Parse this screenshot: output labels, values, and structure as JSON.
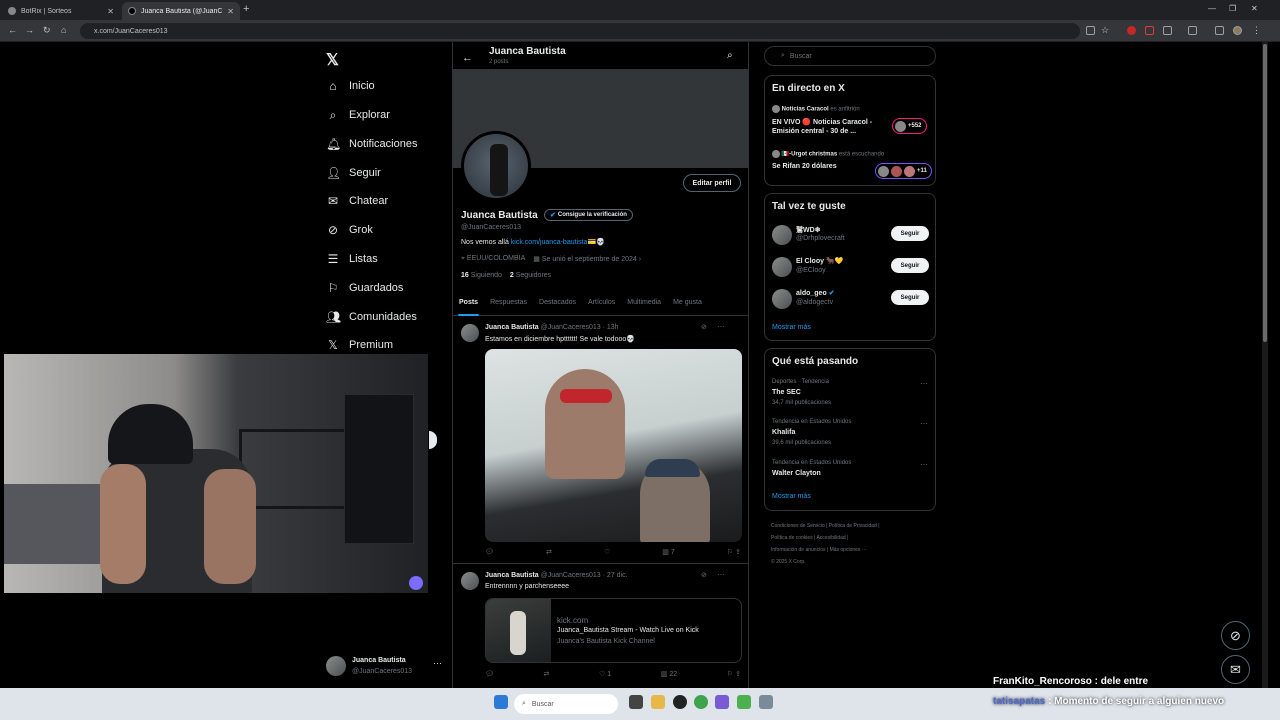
{
  "browser": {
    "tabs": [
      {
        "title": "BotRix | Sorteos"
      },
      {
        "title": "Juanca Bautista (@JuanCacer…"
      }
    ],
    "url": "x.com/JuanCaceres013"
  },
  "nav": {
    "logo": "𝕏",
    "items": [
      {
        "label": "Inicio",
        "icon": "home-icon"
      },
      {
        "label": "Explorar",
        "icon": "search-icon"
      },
      {
        "label": "Notificaciones",
        "icon": "bell-icon"
      },
      {
        "label": "Seguir",
        "icon": "follow-icon"
      },
      {
        "label": "Chatear",
        "icon": "mail-icon"
      },
      {
        "label": "Grok",
        "icon": "grok-icon"
      },
      {
        "label": "Listas",
        "icon": "list-icon"
      },
      {
        "label": "Guardados",
        "icon": "bookmark-icon"
      },
      {
        "label": "Comunidades",
        "icon": "communities-icon"
      },
      {
        "label": "Premium",
        "icon": "x-icon"
      }
    ],
    "account": {
      "name": "Juanca Bautista",
      "handle": "@JuanCaceres013"
    }
  },
  "profile": {
    "header_name": "Juanca Bautista",
    "header_posts": "2 posts",
    "name": "Juanca Bautista",
    "verify_label": "Consigue la verificación",
    "handle": "@JuanCaceres013",
    "edit_label": "Editar perfil",
    "bio_text": "Nos vemos allá ",
    "bio_link": "kick.com/juanca-bautista",
    "bio_emoji": "💳💀",
    "location": "EEUU/COLOMBIA",
    "joined": "Se unió el septiembre de 2024",
    "following_count": "16",
    "following_label": "Siguiendo",
    "followers_count": "2",
    "followers_label": "Seguidores",
    "tabs": [
      "Posts",
      "Respuestas",
      "Destacados",
      "Artículos",
      "Multimedia",
      "Me gusta"
    ]
  },
  "posts": [
    {
      "name": "Juanca Bautista",
      "handle": "@JuanCaceres013",
      "time": "· 13h",
      "text": "Estamos en diciembre hptttttt! Se vale todooo💀",
      "views": "7",
      "likes": ""
    },
    {
      "name": "Juanca Bautista",
      "handle": "@JuanCaceres013",
      "time": "· 27 dic.",
      "text": "Entrennnn y parchenseeee",
      "card_domain": "kick.com",
      "card_title": "Juanca_Bautista Stream - Watch Live on Kick",
      "card_desc": "Juanca's Bautista Kick Channel",
      "likes": "1",
      "views": "22"
    }
  ],
  "right": {
    "search_placeholder": "Buscar",
    "live_title": "En directo en X",
    "live": [
      {
        "host": "Noticias Caracol",
        "role": "es anfitrión",
        "title_line1": "EN VIVO 🔴 Noticias Caracol -",
        "title_line2": "Emisión central - 30 de ...",
        "count": "+552"
      },
      {
        "host": "🇲🇽-Urgot christmas",
        "role": "está escuchando",
        "title_line1": "Se Rifan 20 dólares",
        "count": "+11"
      }
    ],
    "wtf_title": "Tal vez te guste",
    "wtf": [
      {
        "name": "鷲WD❄",
        "handle": "@Drhplovecraft",
        "button": "Seguir"
      },
      {
        "name": "El Clooy 🐂💛",
        "handle": "@EClooy",
        "button": "Seguir"
      },
      {
        "name": "aldo_geo",
        "handle": "@aldogectv",
        "button": "Seguir"
      }
    ],
    "show_more": "Mostrar más",
    "trends_title": "Qué está pasando",
    "trends": [
      {
        "context": "Deportes · Tendencia",
        "topic": "The SEC",
        "posts": "34,7 mil publicaciones"
      },
      {
        "context": "Tendencia en Estados Unidos",
        "topic": "Khalifa",
        "posts": "39,6 mil publicaciones"
      },
      {
        "context": "Tendencia en Estados Unidos",
        "topic": "Walter Clayton",
        "posts": ""
      }
    ],
    "footer": [
      "Condiciones de Servicio",
      "Política de Privacidad",
      "Política de cookies",
      "Accesibilidad",
      "Información de anuncios",
      "Más opciones ···",
      "© 2025 X Corp."
    ]
  },
  "chat": {
    "line1": "FranKito_Rencoroso : dele entre",
    "line2_user": "tatisapatas",
    "line2_text": ": Momento de seguir a alguien nuevo"
  },
  "taskbar": {
    "search_placeholder": "Buscar"
  }
}
